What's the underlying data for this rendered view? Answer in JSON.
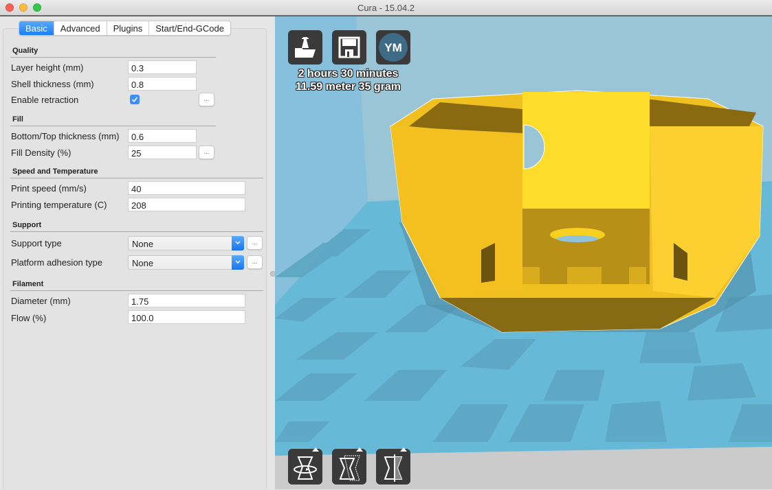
{
  "window": {
    "title": "Cura - 15.04.2"
  },
  "tabs": [
    {
      "label": "Basic",
      "active": true
    },
    {
      "label": "Advanced",
      "active": false
    },
    {
      "label": "Plugins",
      "active": false
    },
    {
      "label": "Start/End-GCode",
      "active": false
    }
  ],
  "sections": {
    "quality": {
      "title": "Quality",
      "layer_height": {
        "label": "Layer height (mm)",
        "value": "0.3"
      },
      "shell_thickness": {
        "label": "Shell thickness (mm)",
        "value": "0.8"
      },
      "enable_retraction": {
        "label": "Enable retraction",
        "checked": true,
        "more": "..."
      }
    },
    "fill": {
      "title": "Fill",
      "bottom_top_thickness": {
        "label": "Bottom/Top thickness (mm)",
        "value": "0.6"
      },
      "fill_density": {
        "label": "Fill Density (%)",
        "value": "25",
        "more": "..."
      }
    },
    "speed": {
      "title": "Speed and Temperature",
      "print_speed": {
        "label": "Print speed (mm/s)",
        "value": "40"
      },
      "printing_temperature": {
        "label": "Printing temperature (C)",
        "value": "208"
      }
    },
    "support": {
      "title": "Support",
      "support_type": {
        "label": "Support type",
        "value": "None",
        "more": "..."
      },
      "platform_adhesion": {
        "label": "Platform adhesion type",
        "value": "None",
        "more": "..."
      }
    },
    "filament": {
      "title": "Filament",
      "diameter": {
        "label": "Diameter (mm)",
        "value": "1.75"
      },
      "flow": {
        "label": "Flow (%)",
        "value": "100.0"
      }
    }
  },
  "viewport": {
    "toolbar": [
      {
        "name": "load",
        "icon": "load-model-icon"
      },
      {
        "name": "save",
        "icon": "save-icon"
      },
      {
        "name": "youmagine",
        "icon": "youmagine-icon",
        "text": "YM"
      }
    ],
    "print_time": "2 hours 30 minutes",
    "print_material": "11.59 meter 35 gram",
    "tools": [
      {
        "name": "rotate",
        "icon": "rotate-icon"
      },
      {
        "name": "scale",
        "icon": "scale-icon"
      },
      {
        "name": "mirror",
        "icon": "mirror-icon"
      }
    ]
  },
  "colors": {
    "accent": "#1b7ef6",
    "model": "#f5c526",
    "platform_light": "#67b9d8",
    "platform_dark": "#5da7c2",
    "wall": "#8fc3da"
  }
}
